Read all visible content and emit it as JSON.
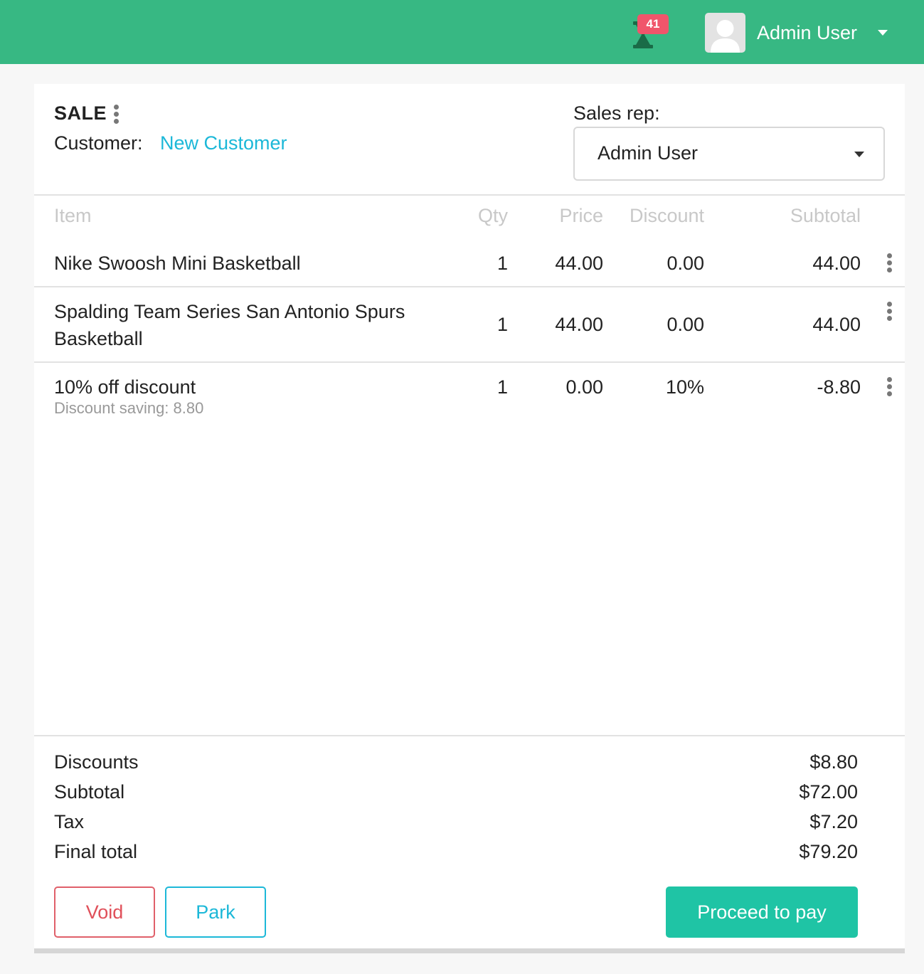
{
  "header": {
    "notification_count": "41",
    "user_name": "Admin User"
  },
  "sale": {
    "title": "SALE",
    "customer_label": "Customer:",
    "customer_link": "New Customer",
    "sales_rep_label": "Sales rep:",
    "sales_rep_value": "Admin User"
  },
  "table": {
    "columns": [
      "Item",
      "Qty",
      "Price",
      "Discount",
      "Subtotal"
    ],
    "rows": [
      {
        "item_line1": "Nike Swoosh Mini Basketball",
        "item_line2": "",
        "qty": "1",
        "price": "44.00",
        "discount": "0.00",
        "subtotal": "44.00",
        "note": ""
      },
      {
        "item_line1": "Spalding Team Series San Antonio Spurs",
        "item_line2": "Basketball",
        "qty": "1",
        "price": "44.00",
        "discount": "0.00",
        "subtotal": "44.00",
        "note": ""
      },
      {
        "item_line1": "10% off discount",
        "item_line2": "",
        "qty": "1",
        "price": "0.00",
        "discount": "10%",
        "subtotal": "-8.80",
        "note": "Discount saving: 8.80"
      }
    ]
  },
  "summary": {
    "discounts_label": "Discounts",
    "discounts_value": "$8.80",
    "subtotal_label": "Subtotal",
    "subtotal_value": "$72.00",
    "tax_label": "Tax",
    "tax_value": "$7.20",
    "final_label": "Final total",
    "final_value": "$79.20"
  },
  "actions": {
    "void": "Void",
    "park": "Park",
    "pay": "Proceed to pay"
  },
  "colors": {
    "topbar": "#37b883",
    "link": "#1cb8d8",
    "badge": "#f0556b",
    "pay_button": "#1fc4a5",
    "void_button": "#e0505a"
  },
  "icons": {
    "notification": "hourglass-icon",
    "row_menu": "kebab-menu-icon",
    "avatar": "user-avatar-icon",
    "dropdown": "caret-down-icon"
  }
}
